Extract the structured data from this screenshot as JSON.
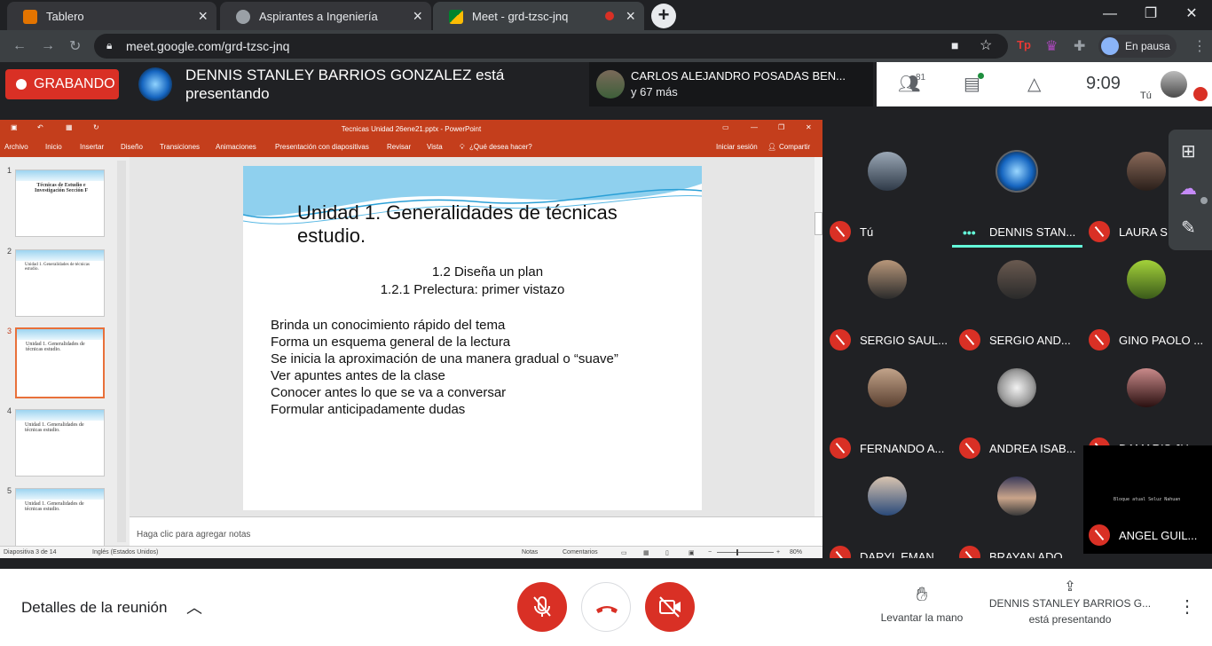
{
  "browser": {
    "tabs": [
      {
        "title": "Tablero",
        "active": false,
        "favicon_color": "#e37400"
      },
      {
        "title": "Aspirantes a Ingeniería",
        "active": false,
        "favicon_color": "#9aa0a6"
      },
      {
        "title": "Meet - grd-tzsc-jnq",
        "active": true,
        "favicon_color": "#00832d"
      }
    ],
    "url": "meet.google.com/grd-tzsc-jnq",
    "profile_label": "En pausa"
  },
  "meet": {
    "recording_label": "GRABANDO",
    "presenter_banner": "DENNIS STANLEY BARRIOS GONZALEZ está presentando",
    "joiner_name": "CARLOS ALEJANDRO POSADAS BEN...",
    "joiner_more": "y 67 más",
    "participant_count": "81",
    "time": "9:09",
    "self_label": "Tú"
  },
  "powerpoint": {
    "window_title": "Tecnicas Unidad 26ene21.pptx - PowerPoint",
    "ribbon_tabs": [
      "Archivo",
      "Inicio",
      "Insertar",
      "Diseño",
      "Transiciones",
      "Animaciones",
      "Presentación con diapositivas",
      "Revisar",
      "Vista",
      "¿Qué desea hacer?"
    ],
    "sign_in": "Iniciar sesión",
    "share": "Compartir",
    "thumbnails": [
      {
        "num": "1",
        "text": "Técnicas de Estudio e Investigación Sección F"
      },
      {
        "num": "2",
        "text": "Unidad 1. Generalidades de técnicas estudio."
      },
      {
        "num": "3",
        "text": "Unidad 1. Generalidades de técnicas estudio."
      },
      {
        "num": "4",
        "text": "Unidad 1. Generalidades de técnicas estudio."
      },
      {
        "num": "5",
        "text": "Unidad 1. Generalidades de técnicas estudio."
      }
    ],
    "slide": {
      "title": "Unidad 1. Generalidades de técnicas estudio.",
      "subtitle1": "1.2 Diseña un plan",
      "subtitle2": "1.2.1 Prelectura: primer vistazo",
      "bullets": [
        "Brinda un conocimiento rápido del tema",
        "Forma un esquema general de la lectura",
        "Se inicia la aproximación de una manera gradual o “suave”",
        "Ver apuntes antes de la clase",
        "Conocer antes lo que se va a conversar",
        "Formular anticipadamente dudas"
      ]
    },
    "notes_placeholder": "Haga clic para agregar notas",
    "status": {
      "slide_pos": "Diapositiva 3 de 14",
      "language": "Inglés (Estados Unidos)",
      "notes": "Notas",
      "comments": "Comentarios",
      "zoom": "80%"
    }
  },
  "participants": [
    {
      "name": "Tú",
      "avatar_color": "#5d6d7e"
    },
    {
      "name": "DENNIS STAN...",
      "avatar_color": "#1565c0"
    },
    {
      "name": "LAURA S",
      "avatar_color": "#6b4a3a"
    },
    {
      "name": "SERGIO SAUL...",
      "avatar_color": "#8a6b55"
    },
    {
      "name": "SERGIO AND...",
      "avatar_color": "#4a3a30"
    },
    {
      "name": "GINO PAOLO ...",
      "avatar_color": "#7fae2a"
    },
    {
      "name": "FERNANDO A...",
      "avatar_color": "#9a7a64"
    },
    {
      "name": "ANDREA ISAB...",
      "avatar_color": "#d9d9d9"
    },
    {
      "name": "DAMARIS JU...",
      "avatar_color": "#5a2a2a"
    },
    {
      "name": "DARYL EMAN...",
      "avatar_color": "#7a8a9a"
    },
    {
      "name": "BRAYAN ADO...",
      "avatar_color": "#3a3a5a"
    },
    {
      "name": "ANGEL GUIL...",
      "avatar_color": "#000000"
    }
  ],
  "black_tile_text": "Bloque atual Seluz Nahuan",
  "bottom": {
    "details": "Detalles de la reunión",
    "raise_hand": "Levantar la mano",
    "presenting_name": "DENNIS STANLEY BARRIOS G...",
    "presenting_status": "está presentando"
  },
  "colors": {
    "record_red": "#d93025",
    "ppt_orange": "#c43e1c",
    "meet_dark": "#202124",
    "speaking_teal": "#64ffda"
  }
}
